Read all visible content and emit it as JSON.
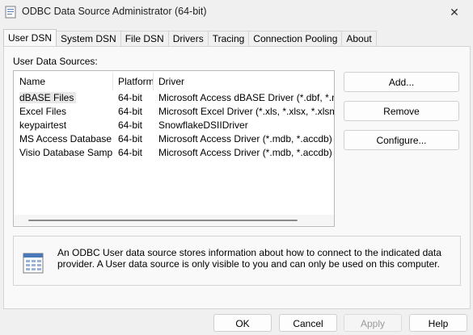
{
  "window": {
    "title": "ODBC Data Source Administrator (64-bit)",
    "controls": {
      "close": "✕"
    }
  },
  "tabs": [
    {
      "label": "User DSN",
      "active": true
    },
    {
      "label": "System DSN"
    },
    {
      "label": "File DSN"
    },
    {
      "label": "Drivers"
    },
    {
      "label": "Tracing"
    },
    {
      "label": "Connection Pooling"
    },
    {
      "label": "About"
    }
  ],
  "user_dsn": {
    "section_label": "User Data Sources:",
    "columns": [
      "Name",
      "Platform",
      "Driver"
    ],
    "rows": [
      {
        "name": "dBASE Files",
        "platform": "64-bit",
        "driver": "Microsoft Access dBASE Driver (*.dbf, *.ndx, *.mdx)",
        "selected": true
      },
      {
        "name": "Excel Files",
        "platform": "64-bit",
        "driver": "Microsoft Excel Driver (*.xls, *.xlsx, *.xlsm, *.xlsb)"
      },
      {
        "name": "keypairtest",
        "platform": "64-bit",
        "driver": "SnowflakeDSIIDriver"
      },
      {
        "name": "MS Access Database",
        "platform": "64-bit",
        "driver": "Microsoft Access Driver (*.mdb, *.accdb)"
      },
      {
        "name": "Visio Database Samples",
        "platform": "64-bit",
        "driver": "Microsoft Access Driver (*.mdb, *.accdb)"
      }
    ],
    "buttons": {
      "add": "Add...",
      "remove": "Remove",
      "configure": "Configure..."
    },
    "info_text": "An ODBC User data source stores information about how to connect to the indicated data provider.   A User data source is only visible to you and can only be used on this computer."
  },
  "footer": {
    "ok": "OK",
    "cancel": "Cancel",
    "apply": "Apply",
    "help": "Help"
  },
  "colors": {
    "accent": "#0067c0",
    "selection": "#e8e8e8"
  }
}
